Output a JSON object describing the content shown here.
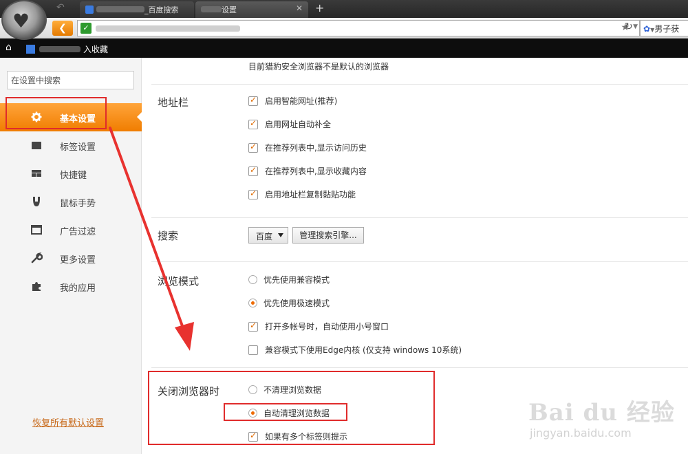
{
  "browser": {
    "tabs": [
      {
        "label": "_百度搜索"
      },
      {
        "label": "设置"
      }
    ],
    "address_search": {
      "text": "男子获"
    },
    "bookmark": {
      "label": "入收藏"
    }
  },
  "sidebar": {
    "search_placeholder": "在设置中搜索",
    "items": [
      {
        "label": "基本设置",
        "icon": "gear-icon",
        "active": true
      },
      {
        "label": "标签设置",
        "icon": "tab-icon"
      },
      {
        "label": "快捷键",
        "icon": "keyboard-icon"
      },
      {
        "label": "鼠标手势",
        "icon": "mouse-icon"
      },
      {
        "label": "广告过滤",
        "icon": "window-icon"
      },
      {
        "label": "更多设置",
        "icon": "wrench-icon"
      },
      {
        "label": "我的应用",
        "icon": "puzzle-icon"
      }
    ],
    "restore_link": "恢复所有默认设置"
  },
  "main": {
    "default_browser_text": "目前猎豹安全浏览器不是默认的浏览器",
    "address_bar": {
      "title": "地址栏",
      "options": [
        {
          "label": "启用智能网址(推荐)",
          "checked": true
        },
        {
          "label": "启用网址自动补全",
          "checked": true
        },
        {
          "label": "在推荐列表中,显示访问历史",
          "checked": true
        },
        {
          "label": "在推荐列表中,显示收藏内容",
          "checked": true
        },
        {
          "label": "启用地址栏复制黏贴功能",
          "checked": true
        }
      ]
    },
    "search": {
      "title": "搜索",
      "engine": "百度",
      "manage_button": "管理搜索引擎..."
    },
    "browse_mode": {
      "title": "浏览模式",
      "radios": [
        {
          "label": "优先使用兼容模式",
          "selected": false
        },
        {
          "label": "优先使用极速模式",
          "selected": true
        }
      ],
      "options": [
        {
          "label": "打开多帐号时，自动使用小号窗口",
          "checked": true
        },
        {
          "label": "兼容模式下使用Edge内核 (仅支持 windows 10系统)",
          "checked": false
        }
      ]
    },
    "on_close": {
      "title": "关闭浏览器时",
      "radios": [
        {
          "label": "不清理浏览数据",
          "selected": false
        },
        {
          "label": "自动清理浏览数据",
          "selected": true
        }
      ],
      "options": [
        {
          "label": "如果有多个标签则提示",
          "checked": true
        }
      ]
    }
  },
  "watermark": {
    "main": "Bai du 经验",
    "sub": "jingyan.baidu.com"
  },
  "colors": {
    "accent": "#f08a00",
    "annotation": "#e02b2b",
    "checkmark": "#e06a00"
  }
}
